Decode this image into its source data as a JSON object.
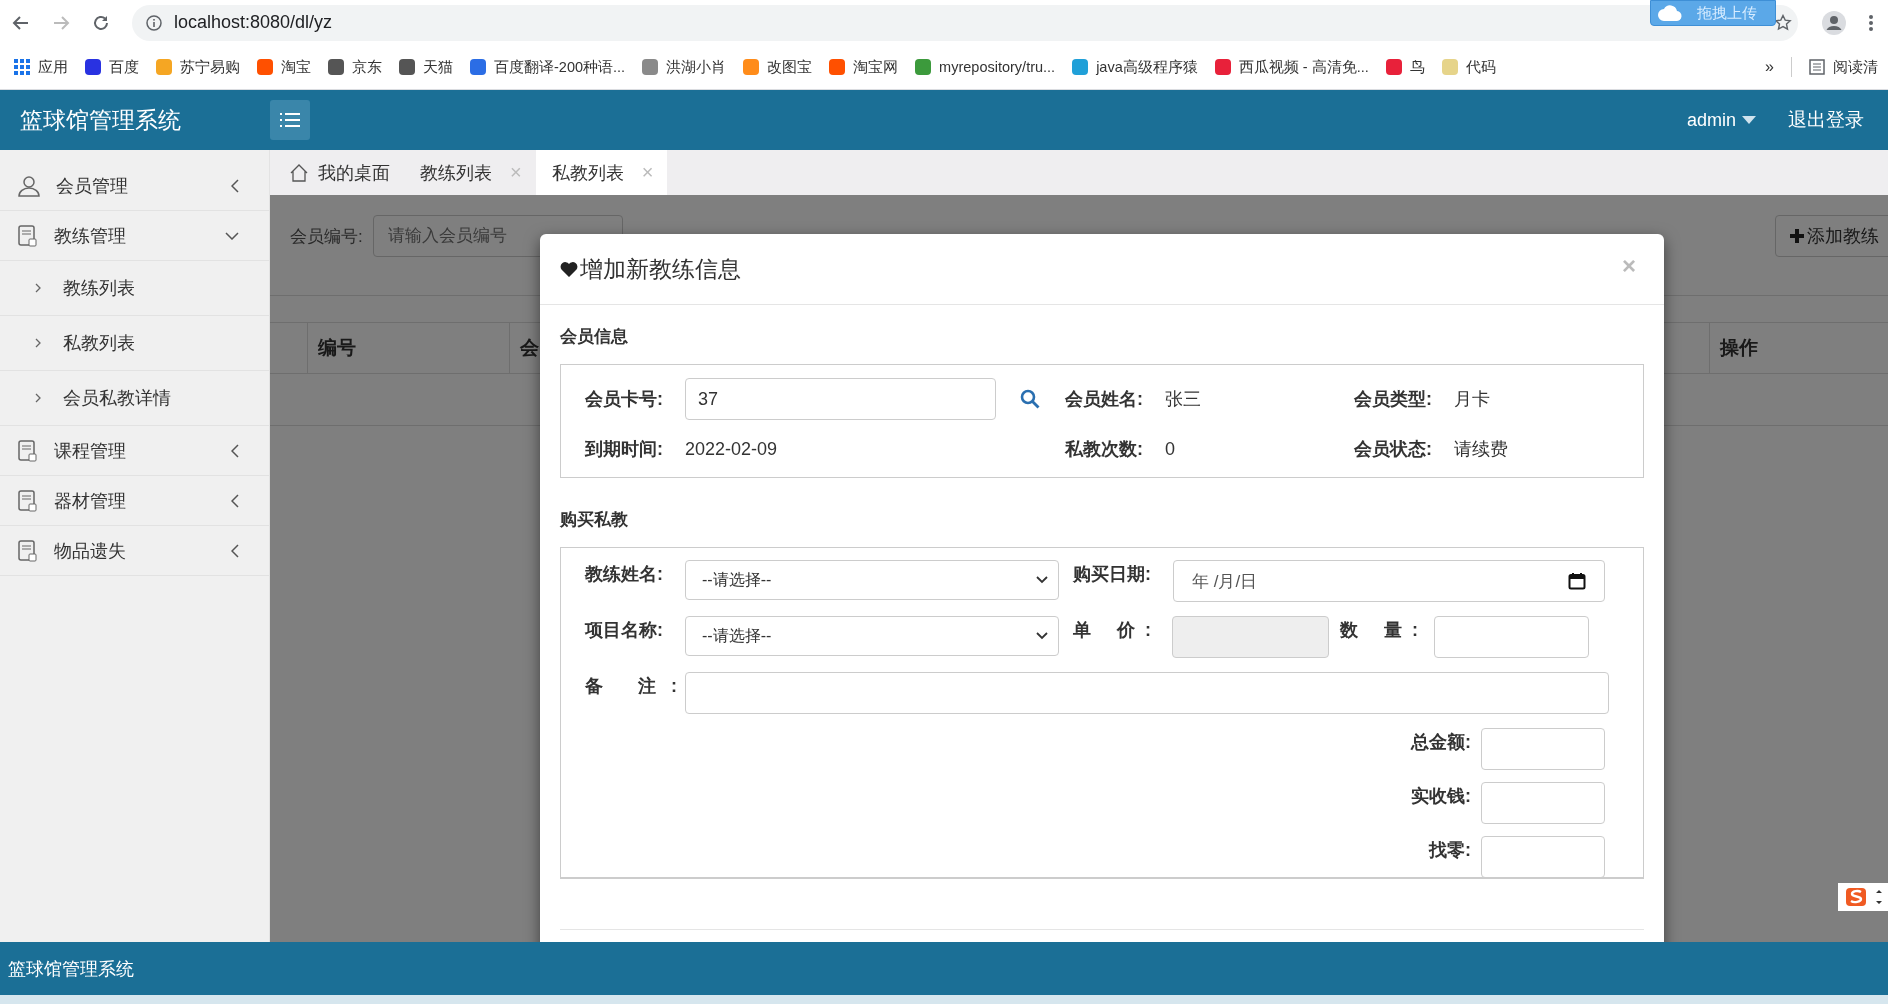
{
  "browser": {
    "url": "localhost:8080/dl/yz",
    "upload_widget": "拖拽上传",
    "bookmarks": [
      {
        "label": "应用",
        "kind": "apps",
        "color": "#1a73e8"
      },
      {
        "label": "百度",
        "kind": "site",
        "color": "#2932e1"
      },
      {
        "label": "苏宁易购",
        "kind": "site",
        "color": "#f5a623"
      },
      {
        "label": "淘宝",
        "kind": "site",
        "color": "#ff5000"
      },
      {
        "label": "京东",
        "kind": "site",
        "color": "#555555"
      },
      {
        "label": "天猫",
        "kind": "site",
        "color": "#555555"
      },
      {
        "label": "百度翻译-200种语...",
        "kind": "site",
        "color": "#2b6de5"
      },
      {
        "label": "洪湖小肖",
        "kind": "site",
        "color": "#8a8a8a"
      },
      {
        "label": "改图宝",
        "kind": "site",
        "color": "#ff8c1a"
      },
      {
        "label": "淘宝网",
        "kind": "site",
        "color": "#ff5000"
      },
      {
        "label": "myrepository/tru...",
        "kind": "site",
        "color": "#3c9a3c"
      },
      {
        "label": "java高级程序猿",
        "kind": "site",
        "color": "#20a0d8"
      },
      {
        "label": "西瓜视频 - 高清免...",
        "kind": "site",
        "color": "#e8213a"
      },
      {
        "label": "鸟",
        "kind": "site",
        "color": "#e8213a"
      },
      {
        "label": "代码",
        "kind": "site",
        "color": "#e6d48a"
      }
    ],
    "more": "»",
    "reading_list": "阅读清"
  },
  "app": {
    "title": "篮球馆管理系统",
    "user": "admin",
    "logout": "退出登录"
  },
  "sidebar": {
    "items": [
      {
        "label": "会员管理",
        "kind": "user",
        "expanded": false
      },
      {
        "label": "教练管理",
        "kind": "doc",
        "expanded": true,
        "children": [
          {
            "label": "教练列表"
          },
          {
            "label": "私教列表"
          },
          {
            "label": "会员私教详情"
          }
        ]
      },
      {
        "label": "课程管理",
        "kind": "doc",
        "expanded": false
      },
      {
        "label": "器材管理",
        "kind": "doc",
        "expanded": false
      },
      {
        "label": "物品遗失",
        "kind": "doc",
        "expanded": false
      }
    ]
  },
  "tabs": [
    {
      "label": "我的桌面",
      "kind": "home",
      "selected": false
    },
    {
      "label": "教练列表",
      "kind": "closable",
      "close": "×",
      "selected": false
    },
    {
      "label": "私教列表",
      "kind": "closable",
      "close": "×",
      "selected": true
    }
  ],
  "page": {
    "filters": [
      {
        "label": "会员编号:",
        "placeholder": "请输入会员编号",
        "kind": "input"
      }
    ],
    "add_button": "添加教练",
    "table": {
      "columns": [
        "编号",
        "会",
        "操作"
      ]
    }
  },
  "modal": {
    "title": "增加新教练信息",
    "close": "×",
    "member_section": "会员信息",
    "card": {
      "label": "会员卡号:",
      "value": "37"
    },
    "member_info": [
      {
        "label": "会员姓名:",
        "value": "张三"
      },
      {
        "label": "会员类型:",
        "value": "月卡"
      },
      {
        "label": "到期时间:",
        "value": "2022-02-09"
      },
      {
        "label": "私教次数:",
        "value": "0"
      },
      {
        "label": "会员状态:",
        "value": "请续费"
      }
    ],
    "purchase_section": "购买私教",
    "coach": {
      "label": "教练姓名:",
      "value": "--请选择--"
    },
    "date": {
      "label": "购买日期:",
      "placeholder": "年 /月/日"
    },
    "project": {
      "label": "项目名称:",
      "value": "--请选择--"
    },
    "price": {
      "label": "单 价:",
      "disabled": true
    },
    "quantity": {
      "label": "数 量:"
    },
    "remark": {
      "label": "备 注:"
    },
    "totals": [
      {
        "label": "总金额:"
      },
      {
        "label": "实收钱:"
      },
      {
        "label": "找零:"
      }
    ]
  },
  "footer": {
    "title": "篮球馆管理系统"
  }
}
